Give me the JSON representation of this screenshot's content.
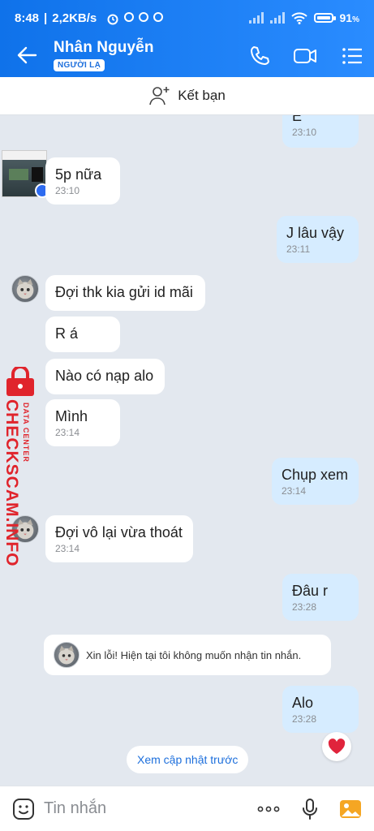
{
  "status_bar": {
    "time": "8:48",
    "net_speed": "2,2KB/s",
    "battery": "91"
  },
  "header": {
    "contact_name": "Nhân Nguyễn",
    "badge": "NGƯỜI LẠ",
    "icons": [
      "back-arrow-icon",
      "phone-icon",
      "video-call-icon",
      "menu-list-icon"
    ]
  },
  "add_friend": {
    "label": "Kết bạn"
  },
  "messages": [
    {
      "dir": "out",
      "text": "E",
      "time": "23:10"
    },
    {
      "dir": "in",
      "text": "5p nữa",
      "time": "23:10"
    },
    {
      "dir": "out",
      "text": "J lâu vậy",
      "time": "23:11"
    },
    {
      "dir": "in",
      "text": "Đợi thk kia gửi id mãi",
      "time": ""
    },
    {
      "dir": "in",
      "text": "R á",
      "time": ""
    },
    {
      "dir": "in",
      "text": "Nào có nạp alo",
      "time": ""
    },
    {
      "dir": "in",
      "text": "Mình",
      "time": "23:14"
    },
    {
      "dir": "out",
      "text": "Chụp xem",
      "time": "23:14"
    },
    {
      "dir": "in",
      "text": "Đợi vô lại vừa thoát",
      "time": "23:14"
    },
    {
      "dir": "out",
      "text": "Đâu r",
      "time": "23:28"
    },
    {
      "dir": "out",
      "text": "Alo",
      "time": "23:28"
    }
  ],
  "system_notice": "Xin lỗi! Hiện tại tôi không muốn nhận tin nhắn.",
  "more_updates": "Xem cập nhật trước",
  "watermark": {
    "big": "CHECKSCAM.INFO",
    "small": "DATA CENTER"
  },
  "input": {
    "placeholder": "Tin nhắn",
    "icons": [
      "emoji-icon",
      "more-dots-icon",
      "microphone-icon",
      "image-icon"
    ]
  },
  "colors": {
    "header": "#1a7ef0",
    "out_bubble": "#d6ecff",
    "in_bubble": "#ffffff",
    "chat_bg": "#e3e8ef",
    "watermark": "#e0242c"
  }
}
